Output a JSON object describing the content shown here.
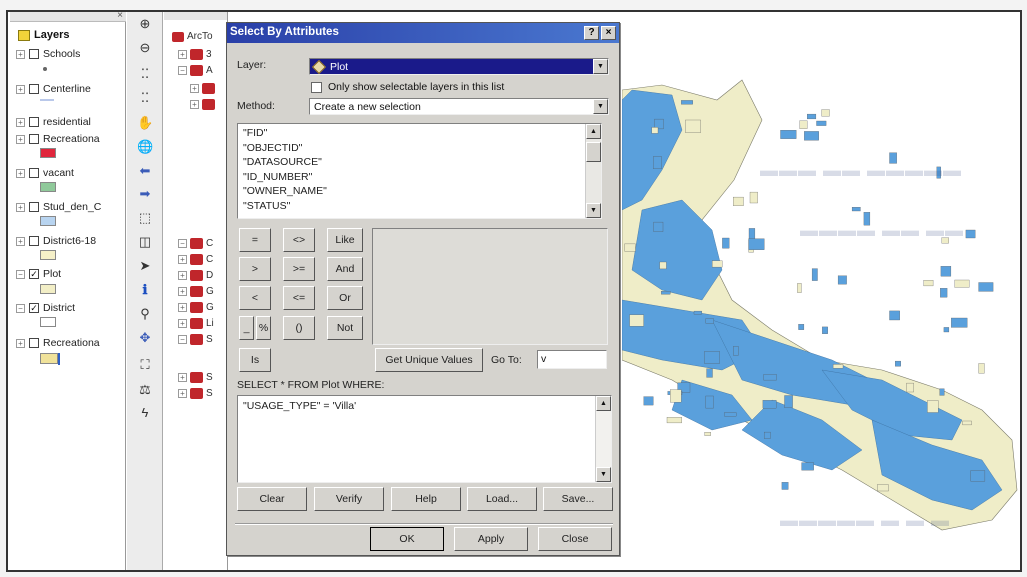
{
  "toc": {
    "root_label": "Layers",
    "layers": [
      {
        "name": "Schools",
        "checked": false,
        "expander": "+",
        "symbol": "dot",
        "color": "#666666"
      },
      {
        "name": "Centerline",
        "checked": false,
        "expander": "+",
        "symbol": "line",
        "color": "#b9c8ea"
      },
      {
        "name": "residential",
        "checked": false,
        "expander": "+",
        "symbol": "none",
        "color": ""
      },
      {
        "name": "Recreationa",
        "checked": false,
        "expander": "+",
        "symbol": "box",
        "color": "#e0263c"
      },
      {
        "name": "vacant",
        "checked": false,
        "expander": "+",
        "symbol": "box",
        "color": "#8fc99a"
      },
      {
        "name": "Stud_den_C",
        "checked": false,
        "expander": "+",
        "symbol": "box",
        "color": "#b8d4f0"
      },
      {
        "name": "District6-18",
        "checked": false,
        "expander": "+",
        "symbol": "box",
        "color": "#f5f0c8"
      },
      {
        "name": "Plot",
        "checked": true,
        "expander": "−",
        "symbol": "box",
        "color": "#f2eec6"
      },
      {
        "name": "District",
        "checked": true,
        "expander": "−",
        "symbol": "box",
        "color": "#ffffff"
      },
      {
        "name": "Recreationa",
        "checked": false,
        "expander": "+",
        "symbol": "box-bar",
        "color": "#f0e29a"
      }
    ],
    "check_mark": "✓"
  },
  "tools": {
    "icons": [
      "zoom-in-icon",
      "zoom-out-icon",
      "fixed-zoom-in-icon",
      "fixed-zoom-out-icon",
      "pan-icon",
      "full-extent-icon",
      "back-icon",
      "forward-icon",
      "select-features-icon",
      "clear-selection-icon",
      "select-elements-icon",
      "identify-icon",
      "find-icon",
      "go-to-xy-icon",
      "hyperlink-icon",
      "measure-icon",
      "lightning-icon"
    ],
    "glyphs": [
      "⊕",
      "⊖",
      "⁚⁚",
      "⁚⁚",
      "✋",
      "🌐",
      "⬅",
      "➡",
      "⬚",
      "◫",
      "➤",
      "ℹ",
      "⚲",
      "✥",
      "⛶",
      "⚖",
      "ϟ"
    ],
    "xy_label": "x y"
  },
  "catalog": {
    "title": "ArcTo",
    "items": [
      "3",
      "A",
      "",
      "",
      "C",
      "C",
      "D",
      "G",
      "G",
      "Li",
      "S",
      "S",
      "S"
    ],
    "expanders": [
      "+",
      "−",
      "+",
      "+",
      "−",
      "+",
      "+",
      "+",
      "+",
      "+",
      "−",
      "+",
      "+"
    ]
  },
  "dialog": {
    "title": "Select By Attributes",
    "help_btn": "?",
    "close_btn": "×",
    "layer_label": "Layer:",
    "layer_value": "Plot",
    "only_selectable_label": "Only show selectable layers in this list",
    "method_label": "Method:",
    "method_value": "Create a new selection",
    "fields": [
      "\"FID\"",
      "\"OBJECTID\"",
      "\"DATASOURCE\"",
      "\"ID_NUMBER\"",
      "\"OWNER_NAME\"",
      "\"STATUS\""
    ],
    "operators": [
      [
        "=",
        "<>",
        "Like"
      ],
      [
        ">",
        ">=",
        "And"
      ],
      [
        "<",
        "<=",
        "Or"
      ],
      [
        "_",
        "%",
        "()",
        "Not"
      ]
    ],
    "is_label": "Is",
    "get_unique_label": "Get Unique Values",
    "goto_label": "Go To:",
    "goto_value": "v",
    "sql_prefix": "SELECT * FROM Plot WHERE:",
    "sql_expression": "\"USAGE_TYPE\" = 'Villa'",
    "clear_label": "Clear",
    "verify_label": "Verify",
    "help_label": "Help",
    "load_label": "Load...",
    "save_label": "Save...",
    "ok_label": "OK",
    "apply_label": "Apply",
    "close_label": "Close"
  },
  "map": {
    "plot_color": "#5aa0dc",
    "district_color": "#efedc8"
  }
}
